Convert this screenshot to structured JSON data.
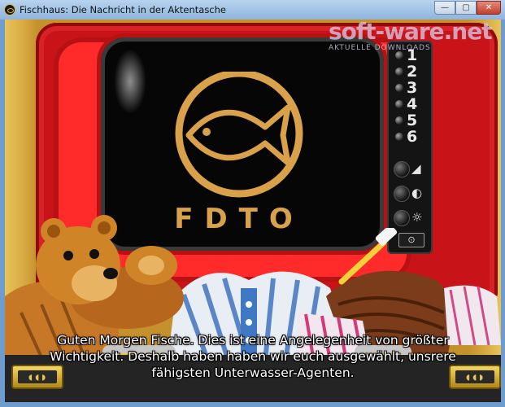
{
  "window": {
    "title": "Fischhaus: Die Nachricht in der Aktentasche",
    "minimize_glyph": "—",
    "maximize_glyph": "▢",
    "close_glyph": "✕"
  },
  "watermark": {
    "main": "soft-ware.net",
    "sub": "AKTUELLE DOWNLOADS"
  },
  "tv": {
    "logo_text": "FDTO",
    "channels": [
      "1",
      "2",
      "3",
      "4",
      "5",
      "6"
    ],
    "controls": [
      {
        "icon": "volume-icon",
        "glyph": "◢"
      },
      {
        "icon": "contrast-icon",
        "glyph": "◐"
      },
      {
        "icon": "brightness-icon",
        "glyph": "☼"
      }
    ],
    "power_glyph": "⊙"
  },
  "subtitle": {
    "line1": "Guten Morgen Fische. Dies ist eine Angelegenheit von größter",
    "line2": "Wichtigkeit. Deshalb haben haben wir euch ausgewählt, unsrere",
    "line3": "fähigsten Unterwasser-Agenten."
  },
  "colors": {
    "tv_red": "#c81418",
    "logo_gold": "#d9a24a",
    "lock_gold": "#e2b83a"
  }
}
